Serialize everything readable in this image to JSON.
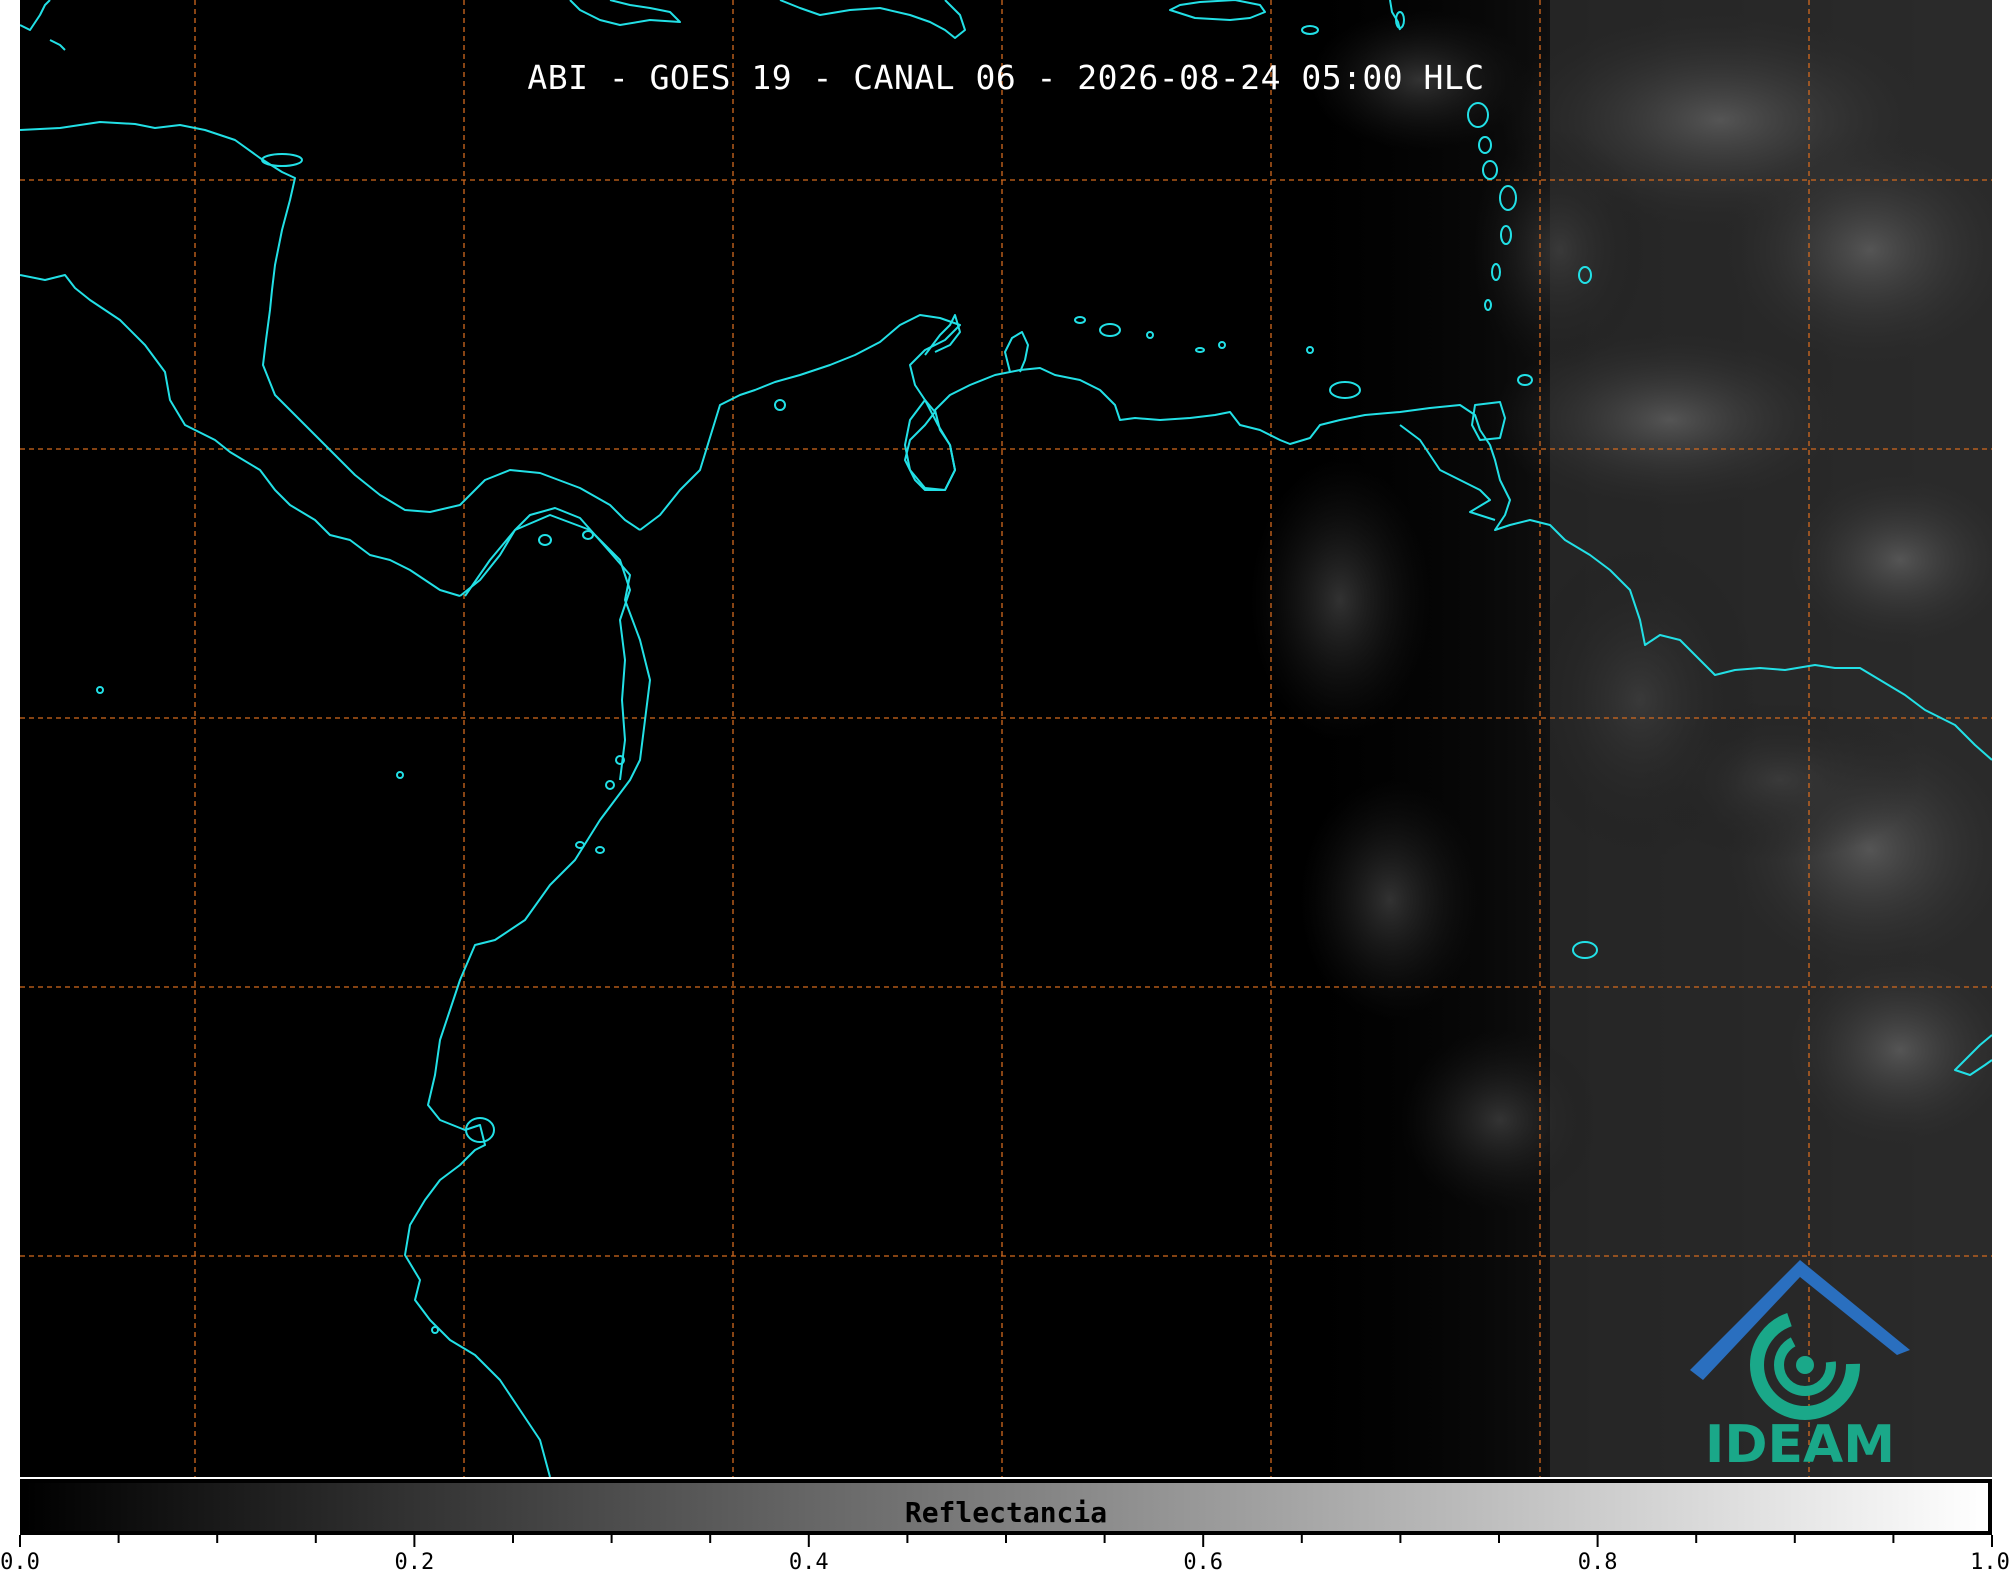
{
  "title": "ABI - GOES 19 - CANAL 06 - 2026-08-24 05:00 HLC",
  "colorbar": {
    "label": "Reflectancia",
    "ticks": [
      "0.0",
      "0.2",
      "0.4",
      "0.6",
      "0.8",
      "1.0"
    ],
    "min": 0.0,
    "max": 1.0
  },
  "logo": {
    "text": "IDEAM"
  },
  "colors": {
    "coastline": "#22e0e6",
    "gridline": "#d2691e",
    "background": "#000000",
    "logo_blue": "#2a6fbf",
    "logo_green": "#1aa889"
  }
}
